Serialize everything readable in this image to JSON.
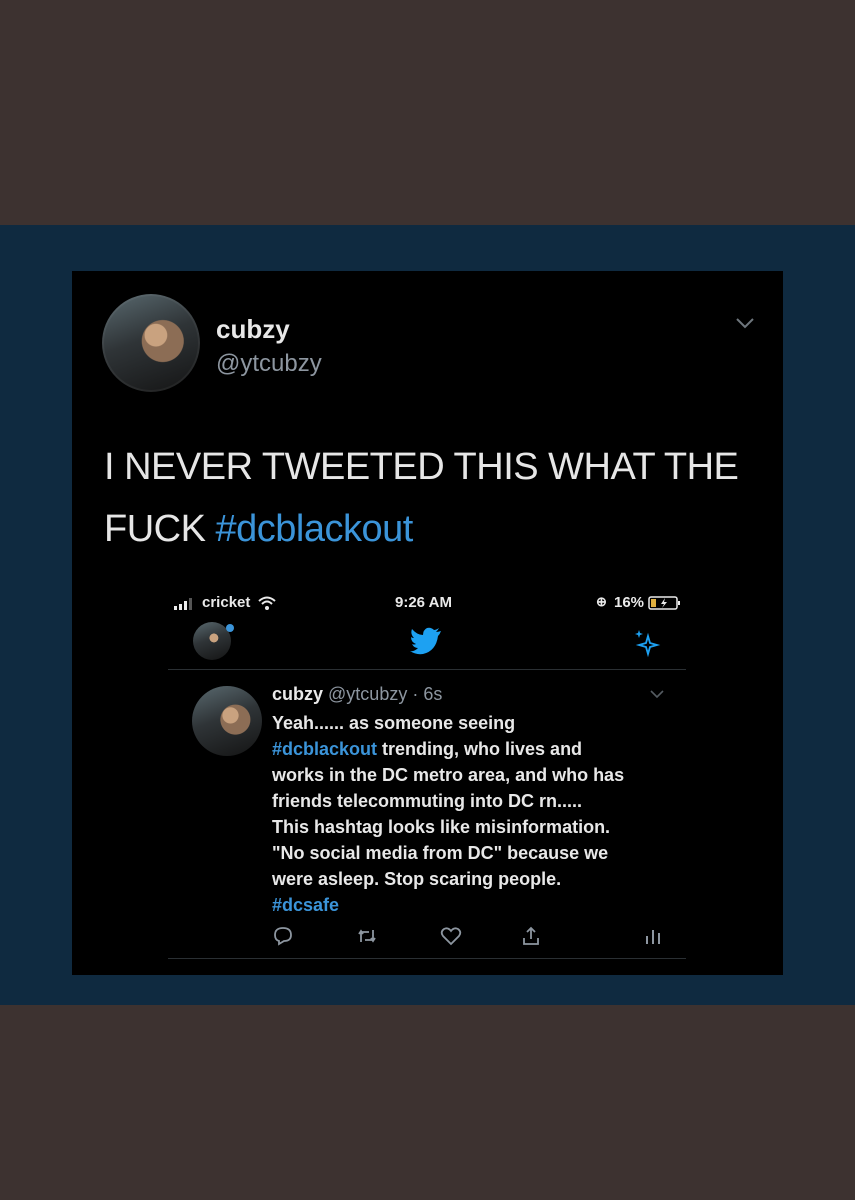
{
  "tweet": {
    "display_name": "cubzy",
    "handle": "@ytcubzy",
    "text_line1": "I NEVER TWEETED THIS WHAT THE",
    "text_line2_prefix": "FUCK ",
    "text_hashtag": "#dcblackout"
  },
  "embedded": {
    "status_bar": {
      "carrier": "cricket",
      "time": "9:26 AM",
      "battery": "16%"
    },
    "inner_tweet": {
      "display_name": "cubzy",
      "handle": "@ytcubzy",
      "separator": " · ",
      "age": "6s",
      "line1": "Yeah...... as someone seeing",
      "line2_hashtag": "#dcblackout",
      "line2_rest": " trending, who lives and",
      "line3": "works in the DC metro area, and who has",
      "line4": "friends telecommuting into DC rn.....",
      "line5": "This hashtag looks like misinformation.",
      "line6": "\"No social media from DC\" because we",
      "line7": "were asleep. Stop scaring people.",
      "line8_hashtag": "#dcsafe"
    },
    "actions": [
      "reply-icon",
      "retweet-icon",
      "like-icon",
      "share-icon",
      "analytics-icon"
    ]
  },
  "colors": {
    "outer_bg": "#3d3230",
    "band_bg": "#0f2a40",
    "panel_bg": "#000000",
    "hashtag": "#3b94d9",
    "twitter_blue": "#1da1f2"
  }
}
